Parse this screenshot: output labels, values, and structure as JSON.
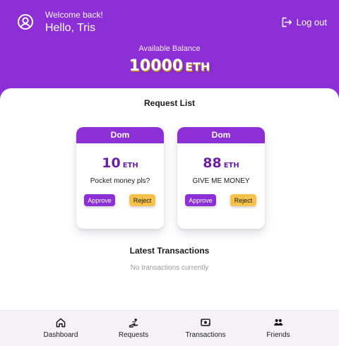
{
  "header": {
    "welcome": "Welcome back!",
    "greeting": "Hello, Tris",
    "logout_label": "Log out",
    "balance_label": "Available Balance",
    "balance_value": "10000",
    "balance_unit": "ETH"
  },
  "requests": {
    "title": "Request List",
    "items": [
      {
        "name": "Dom",
        "amount": "10",
        "unit": "ETH",
        "message": "Pocket money pls?",
        "approve_label": "Approve",
        "reject_label": "Reject"
      },
      {
        "name": "Dom",
        "amount": "88",
        "unit": "ETH",
        "message": "GIVE ME MONEY",
        "approve_label": "Approve",
        "reject_label": "Reject"
      }
    ]
  },
  "transactions": {
    "title": "Latest Transactions",
    "empty_message": "No transactions currently"
  },
  "nav": {
    "items": [
      {
        "label": "Dashboard",
        "icon": "home-icon"
      },
      {
        "label": "Requests",
        "icon": "requests-icon"
      },
      {
        "label": "Transactions",
        "icon": "transactions-icon"
      },
      {
        "label": "Friends",
        "icon": "friends-icon"
      }
    ]
  },
  "colors": {
    "primary": "#8d2fd6",
    "accent": "#f7c24b"
  }
}
